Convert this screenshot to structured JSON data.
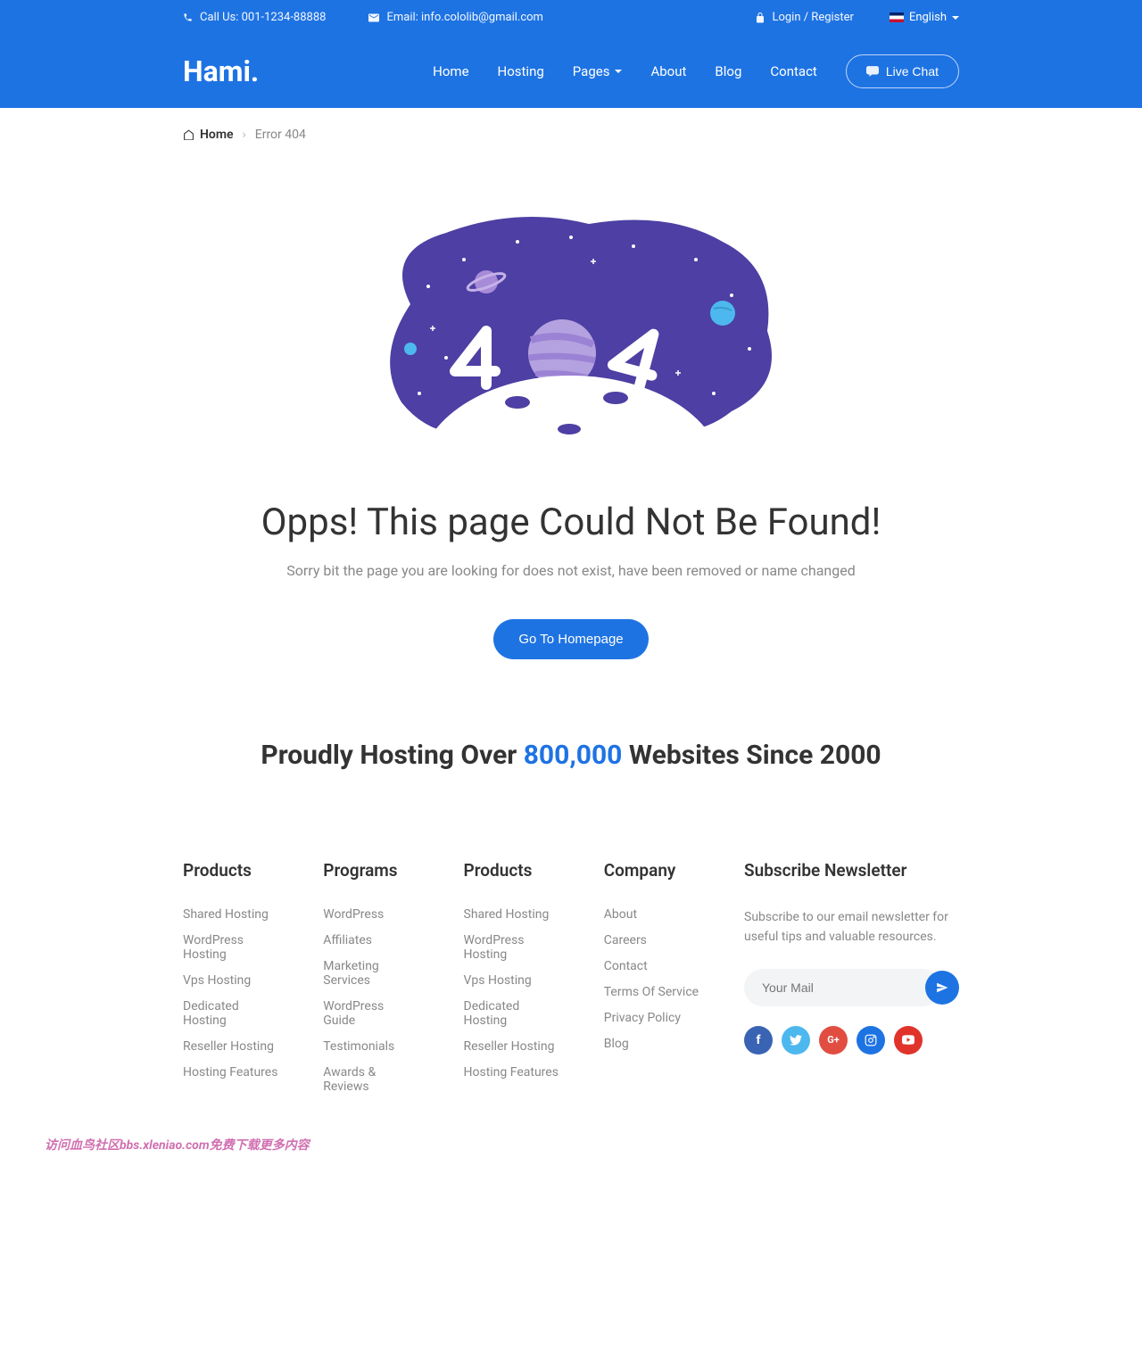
{
  "topbar": {
    "call_label": "Call Us: 001-1234-88888",
    "email_label": "Email: info.cololib@gmail.com",
    "login_label": "Login / Register",
    "lang_label": "English"
  },
  "nav": {
    "logo": "Hami.",
    "items": [
      "Home",
      "Hosting",
      "Pages",
      "About",
      "Blog",
      "Contact"
    ],
    "live_chat": "Live Chat"
  },
  "breadcrumb": {
    "home": "Home",
    "current": "Error 404"
  },
  "error": {
    "title": "Opps! This page Could Not Be Found!",
    "subtitle": "Sorry bit the page you are looking for does not exist, have been removed or name changed",
    "button": "Go To Homepage"
  },
  "proudly": {
    "prefix": "Proudly Hosting Over ",
    "count": "800,000",
    "suffix": " Websites Since 2000"
  },
  "footer": {
    "col1": {
      "title": "Products",
      "items": [
        "Shared Hosting",
        "WordPress Hosting",
        "Vps Hosting",
        "Dedicated Hosting",
        "Reseller Hosting",
        "Hosting Features"
      ]
    },
    "col2": {
      "title": "Programs",
      "items": [
        "WordPress",
        "Affiliates",
        "Marketing Services",
        "WordPress Guide",
        "Testimonials",
        "Awards & Reviews"
      ]
    },
    "col3": {
      "title": "Products",
      "items": [
        "Shared Hosting",
        "WordPress Hosting",
        "Vps Hosting",
        "Dedicated Hosting",
        "Reseller Hosting",
        "Hosting Features"
      ]
    },
    "col4": {
      "title": "Company",
      "items": [
        "About",
        "Careers",
        "Contact",
        "Terms Of Service",
        "Privacy Policy",
        "Blog"
      ]
    },
    "col5": {
      "title": "Subscribe Newsletter",
      "desc": "Subscribe to our email newsletter for useful tips and valuable resources.",
      "placeholder": "Your Mail"
    }
  },
  "watermark": "访问血鸟社区bbs.xleniao.com免费下载更多内容"
}
